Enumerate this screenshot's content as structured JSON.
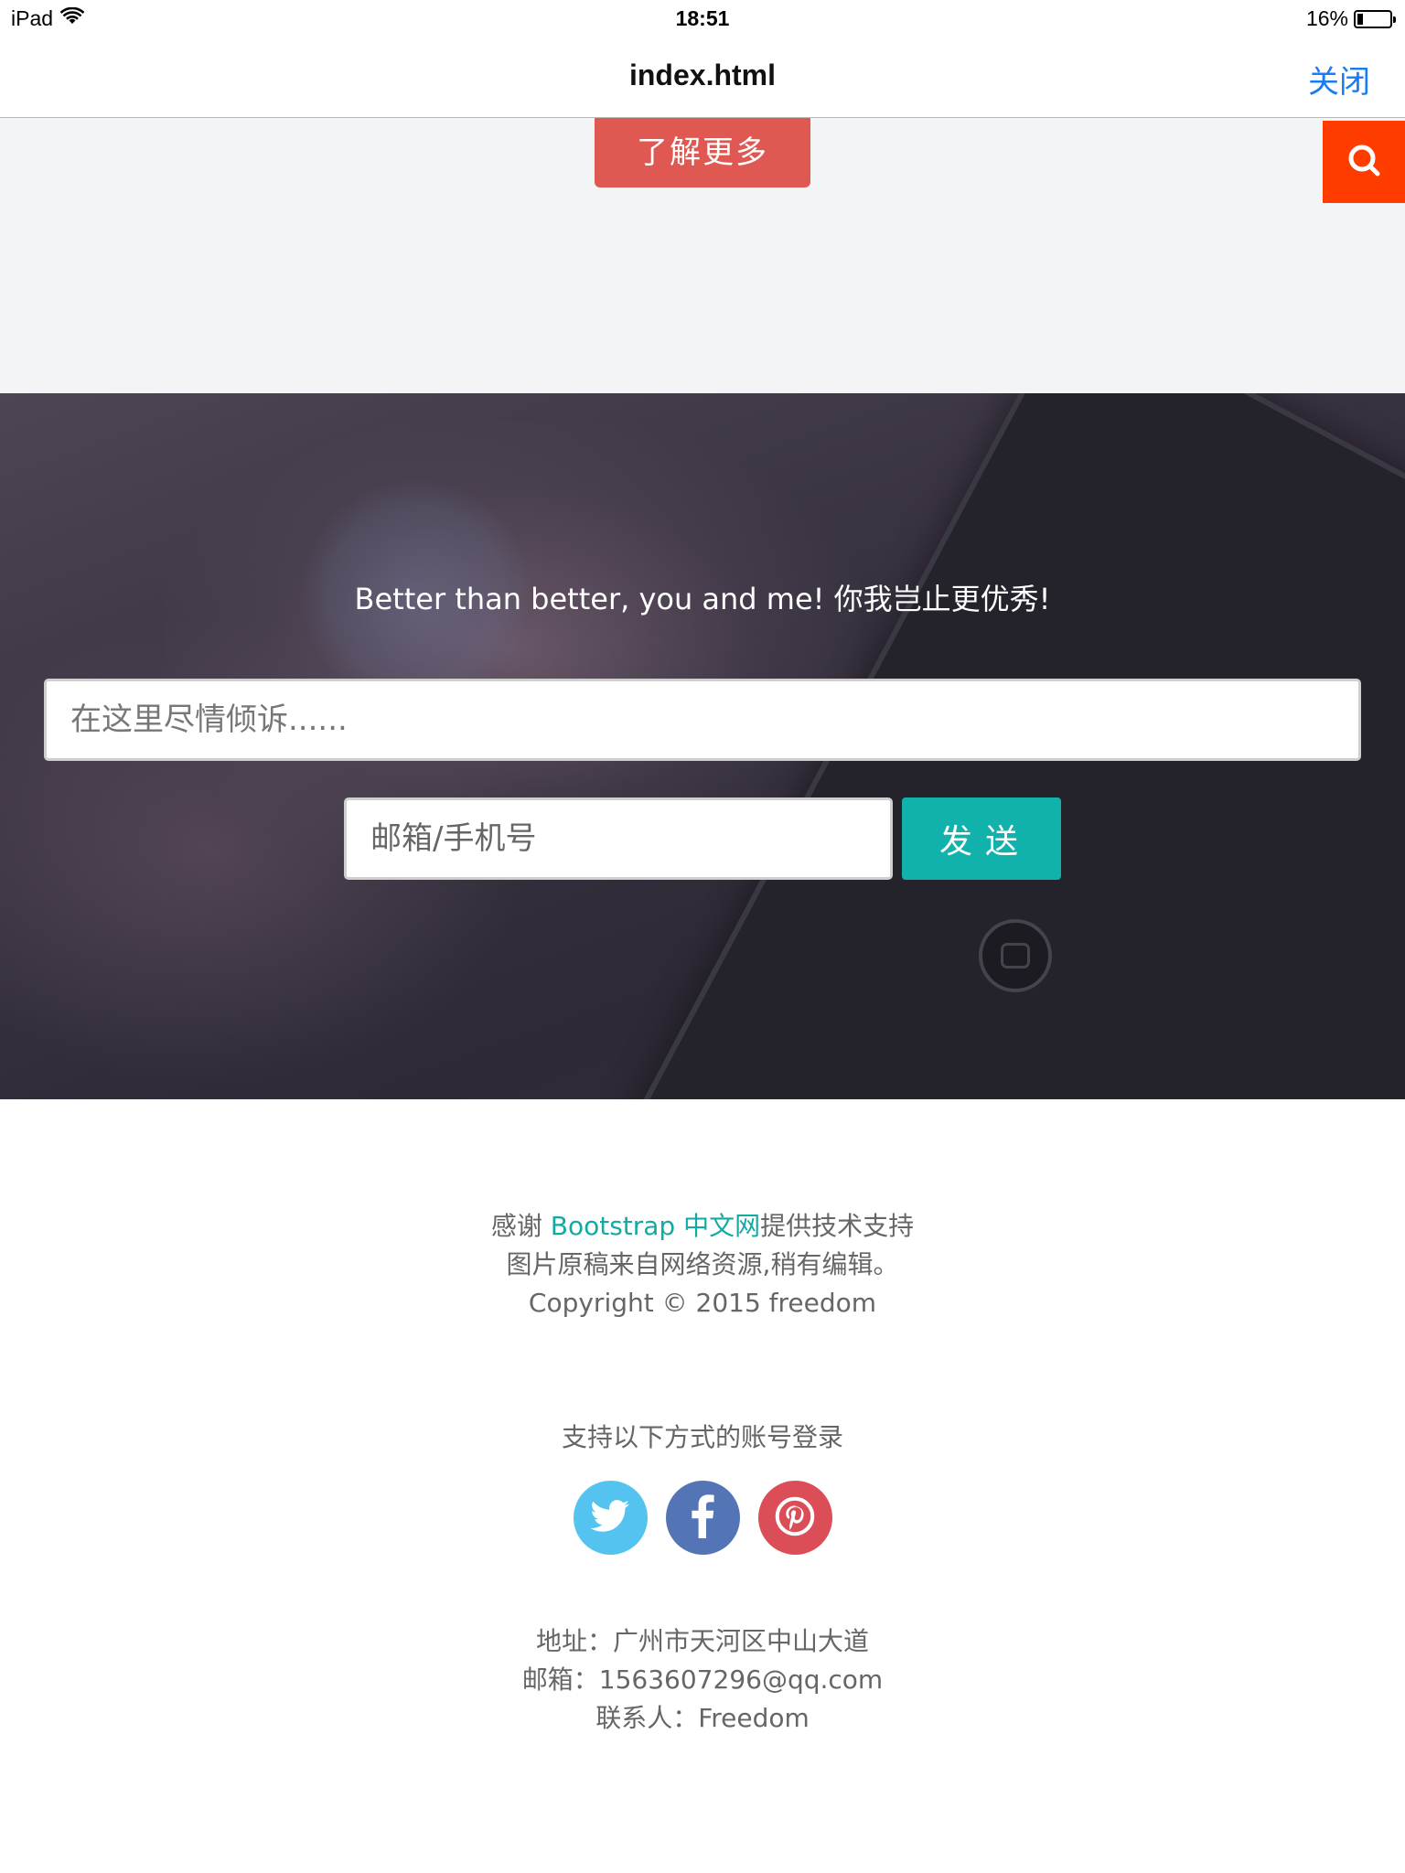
{
  "status_bar": {
    "device": "iPad",
    "time": "18:51",
    "battery": "16%"
  },
  "nav": {
    "title": "index.html",
    "close_label": "关闭"
  },
  "top_section": {
    "learn_more_label": "了解更多",
    "search_icon": "search-icon"
  },
  "hero": {
    "slogan": "Better than better, you and me! 你我岂止更优秀!",
    "message_placeholder": "在这里尽情倾诉......",
    "contact_placeholder": "邮箱/手机号",
    "send_label": "发送"
  },
  "footer": {
    "credit_prefix": "感谢 ",
    "credit_link": "Bootstrap 中文网",
    "credit_suffix": "提供技术支持",
    "image_source": "图片原稿来自网络资源,稍有编辑。",
    "copyright": "Copyright © 2015 freedom",
    "login_title": "支持以下方式的账号登录",
    "social": [
      {
        "name": "twitter",
        "icon": "twitter-icon",
        "color": "#54c3ef"
      },
      {
        "name": "facebook",
        "icon": "facebook-icon",
        "color": "#5475b5"
      },
      {
        "name": "pinterest",
        "icon": "pinterest-icon",
        "color": "#db4e57"
      }
    ],
    "address": "地址：广州市天河区中山大道",
    "email": "邮箱：1563607296@qq.com",
    "contact_person": "联系人：Freedom"
  },
  "colors": {
    "learn_more": "#df5852",
    "search": "#ff3c00",
    "send": "#12b2ac",
    "link": "#13aaa4",
    "close": "#1a7cf2"
  }
}
